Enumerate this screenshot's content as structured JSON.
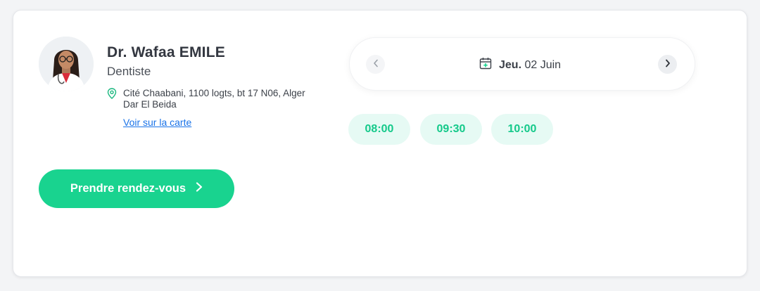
{
  "doctor": {
    "name": "Dr. Wafaa EMILE",
    "specialty": "Dentiste",
    "address": "Cité Chaabani, 1100 logts, bt 17 N06, Alger Dar El Beida",
    "map_link": "Voir sur la carte",
    "avatar_icon": "doctor-portrait"
  },
  "cta": {
    "label": "Prendre rendez-vous",
    "icon": "chevron-right-icon"
  },
  "date_picker": {
    "day": "Jeu.",
    "date": "02 Juin",
    "prev_icon": "chevron-left-icon",
    "next_icon": "chevron-right-icon",
    "calendar_icon": "calendar-icon"
  },
  "slots": [
    "08:00",
    "09:30",
    "10:00"
  ],
  "colors": {
    "accent": "#19d38f",
    "slot_bg": "#e6faf4",
    "slot_text": "#14c98a",
    "link": "#1a73e8"
  }
}
